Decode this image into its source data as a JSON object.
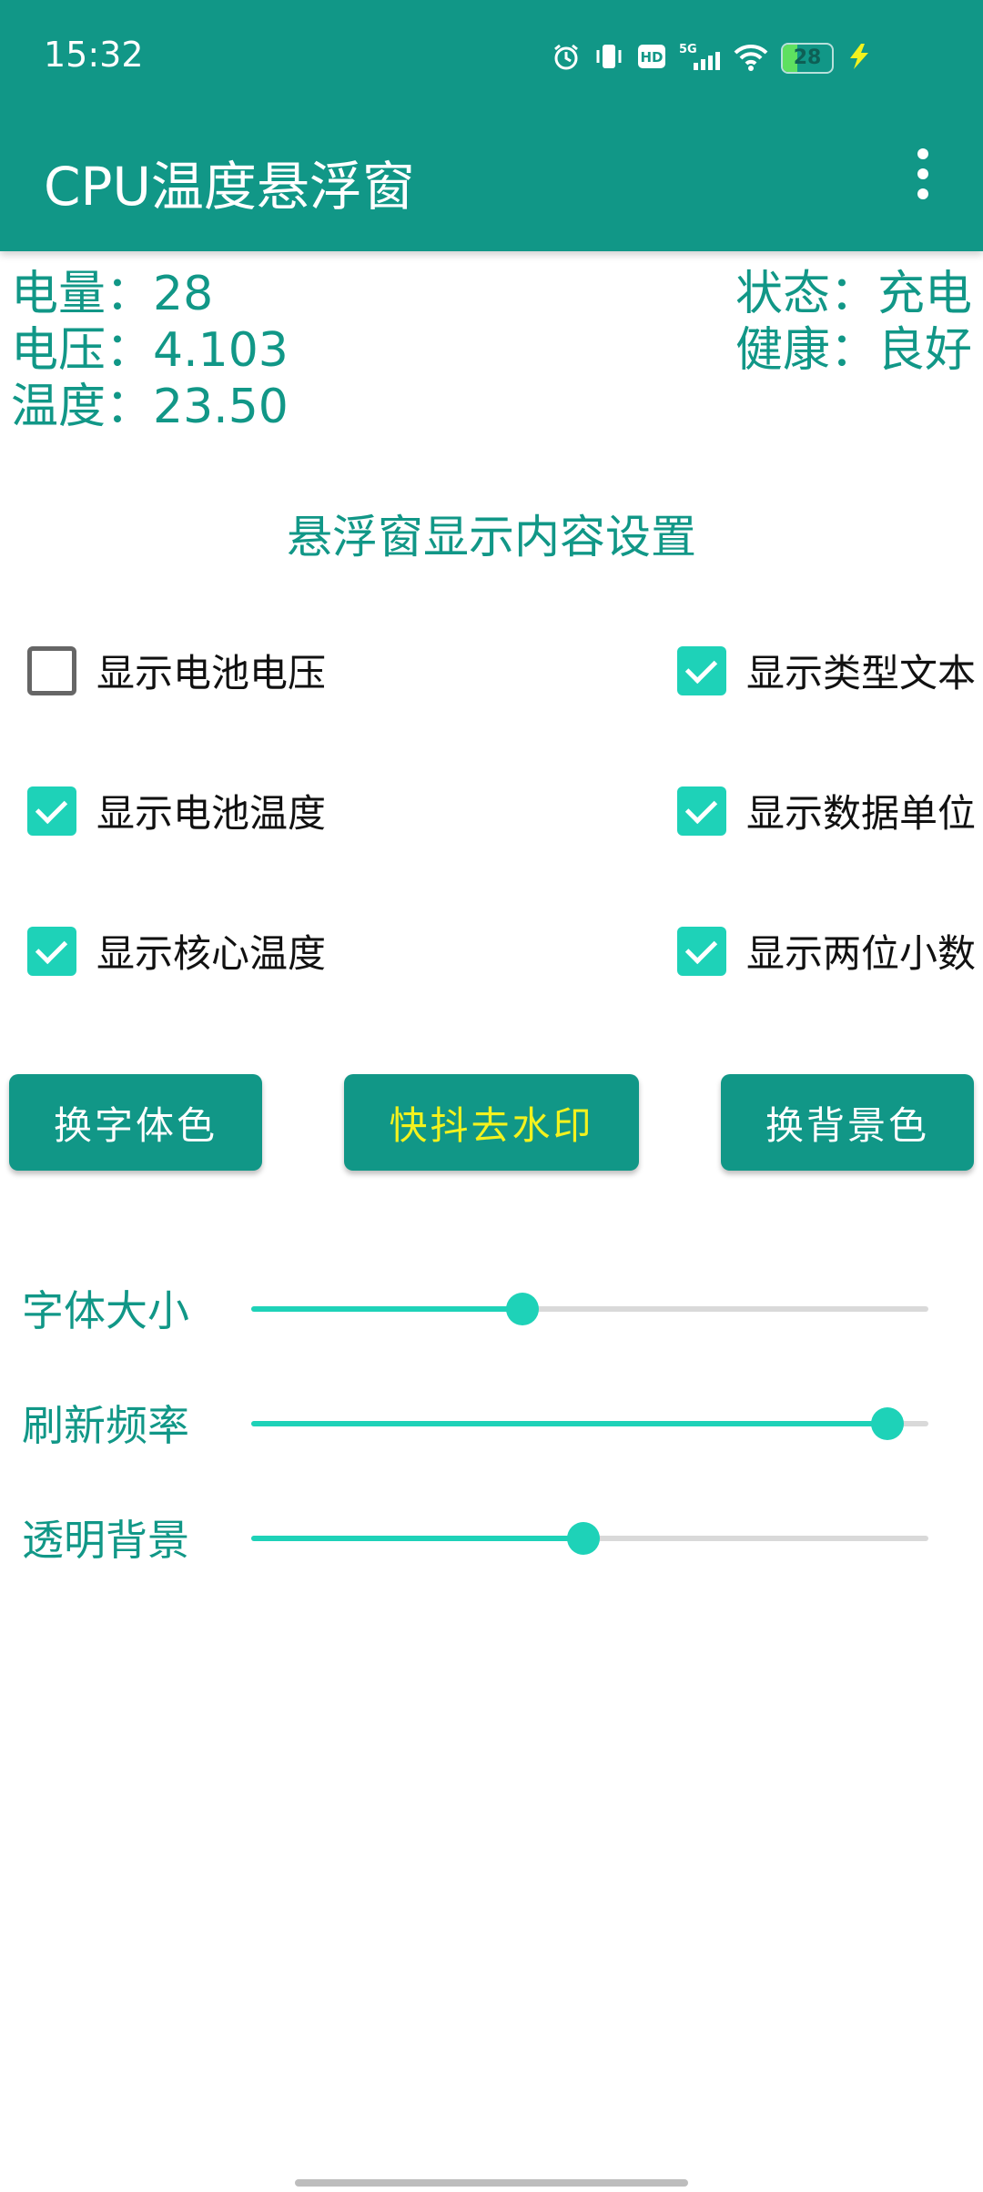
{
  "status_bar": {
    "time": "15:32",
    "icons": [
      "alarm-icon",
      "vibrate-icon",
      "hd-icon",
      "5g-signal-icon",
      "wifi-icon",
      "battery-icon",
      "charging-icon"
    ],
    "battery_level": "28"
  },
  "app_bar": {
    "title": "CPU温度悬浮窗",
    "menu_icon": "more-vert-icon",
    "color": "#119787"
  },
  "battery_info": {
    "level_label": "电量：",
    "level_value": "28",
    "voltage_label": "电压：",
    "voltage_value": "4.103",
    "temp_label": "温度：",
    "temp_value": "23.50",
    "status_label": "状态：",
    "status_value": "充电",
    "health_label": "健康：",
    "health_value": "良好"
  },
  "section_title": "悬浮窗显示内容设置",
  "checkboxes": [
    {
      "label": "显示电池电压",
      "checked": false
    },
    {
      "label": "显示类型文本",
      "checked": true
    },
    {
      "label": "显示电池温度",
      "checked": true
    },
    {
      "label": "显示数据单位",
      "checked": true
    },
    {
      "label": "显示核心温度",
      "checked": true
    },
    {
      "label": "显示两位小数",
      "checked": true
    }
  ],
  "buttons": {
    "font_color": "换字体色",
    "douyin": "快抖去水印",
    "bg_color": "换背景色"
  },
  "sliders": [
    {
      "label": "字体大小",
      "value": 0.4
    },
    {
      "label": "刷新频率",
      "value": 0.94
    },
    {
      "label": "透明背景",
      "value": 0.49
    }
  ],
  "accent_color": "#1ed2b8"
}
